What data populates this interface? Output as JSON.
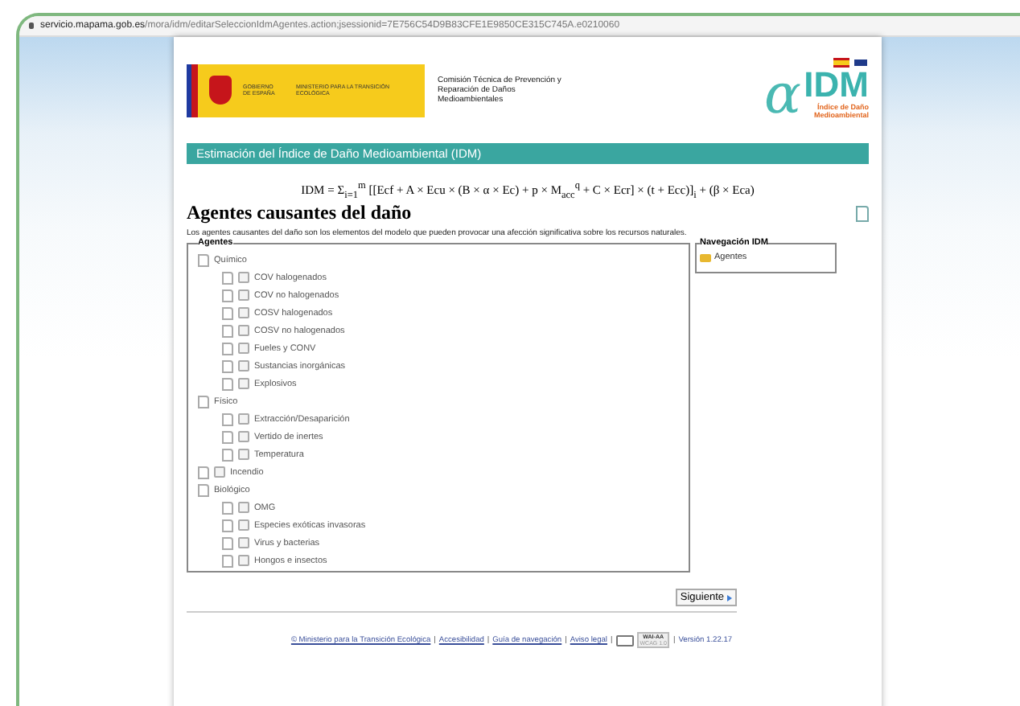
{
  "address_bar": {
    "domain": "servicio.mapama.gob.es",
    "path": "/mora/idm/editarSeleccionIdmAgentes.action;jsessionid=7E756C54D9B83CFE1E9850CE315C745A.e0210060"
  },
  "header": {
    "gov_name": "GOBIERNO DE ESPAÑA",
    "ministry": "MINISTERIO PARA LA TRANSICIÓN ECOLÓGICA",
    "commission": "Comisión Técnica de Prevención y Reparación de Daños Medioambientales",
    "logo_alpha": "α",
    "logo_text": "IDM",
    "logo_subtitle": "Índice de Daño Medioambiental"
  },
  "title_bar": "Estimación del Índice de Daño Medioambiental (IDM)",
  "formula": "IDM = Σ$_{i=1}$$^{m}$ [[Ecf + A × Ecu × (B × α × Ec) + p × M$_{acc}$$^{q}$ + C × Ecr] × (t + Ecc)]$_{i}$ + (β × Eca)",
  "heading": "Agentes causantes del daño",
  "description": "Los agentes causantes del daño son los elementos del modelo que pueden provocar una afección significativa sobre los recursos naturales.",
  "agents": {
    "legend": "Agentes",
    "items": [
      {
        "kind": "group",
        "label": "Químico",
        "children": [
          {
            "label": "COV halogenados",
            "checked": false
          },
          {
            "label": "COV no halogenados",
            "checked": false
          },
          {
            "label": "COSV halogenados",
            "checked": false
          },
          {
            "label": "COSV no halogenados",
            "checked": false
          },
          {
            "label": "Fueles y CONV",
            "checked": false
          },
          {
            "label": "Sustancias inorgánicas",
            "checked": false
          },
          {
            "label": "Explosivos",
            "checked": false
          }
        ]
      },
      {
        "kind": "group",
        "label": "Físico",
        "children": [
          {
            "label": "Extracción/Desaparición",
            "checked": false
          },
          {
            "label": "Vertido de inertes",
            "checked": false
          },
          {
            "label": "Temperatura",
            "checked": false
          }
        ]
      },
      {
        "kind": "leaf",
        "label": "Incendio",
        "checked": false
      },
      {
        "kind": "group",
        "label": "Biológico",
        "children": [
          {
            "label": "OMG",
            "checked": false
          },
          {
            "label": "Especies exóticas invasoras",
            "checked": false
          },
          {
            "label": "Virus y bacterias",
            "checked": false
          },
          {
            "label": "Hongos e insectos",
            "checked": false
          }
        ]
      }
    ]
  },
  "navigation": {
    "legend": "Navegación IDM",
    "items": [
      "Agentes"
    ]
  },
  "next_button": "Siguiente",
  "footer": {
    "links": [
      "© Ministerio para la Transición Ecológica",
      "Accesibilidad",
      "Guía de navegación",
      "Aviso legal"
    ],
    "separator": "|",
    "badge_top": "WAI-AA",
    "badge_bottom": "WCAG 1.0",
    "version": "Versión 1.22.17"
  }
}
